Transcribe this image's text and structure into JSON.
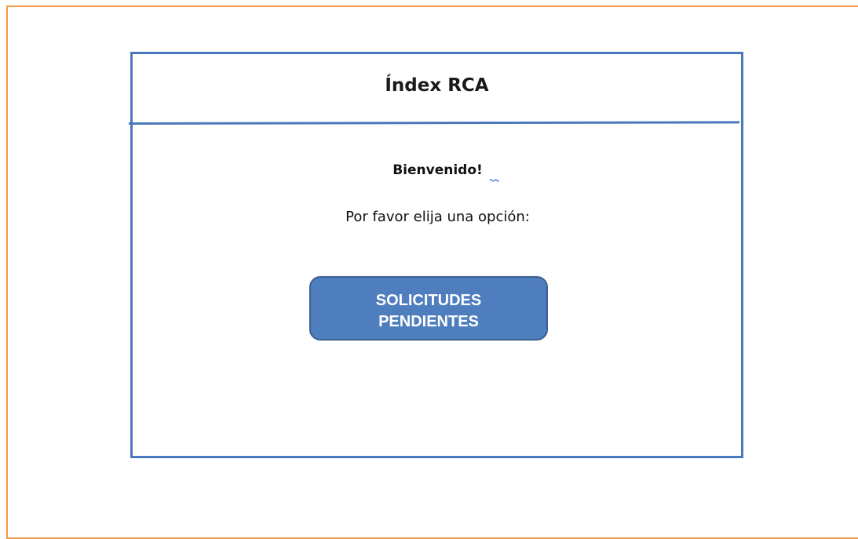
{
  "page": {
    "title": "Índex RCA",
    "welcome": "Bienvenido!",
    "prompt": "Por favor elija una opción:",
    "button": {
      "line1": "SOLICITUDES",
      "line2": "PENDIENTES"
    }
  },
  "colors": {
    "outer_border": "#F29B4B",
    "window_border": "#4A78BD",
    "button_fill": "#4E7EBD",
    "button_border": "#3A5F91",
    "button_text": "#FFFFFF"
  }
}
